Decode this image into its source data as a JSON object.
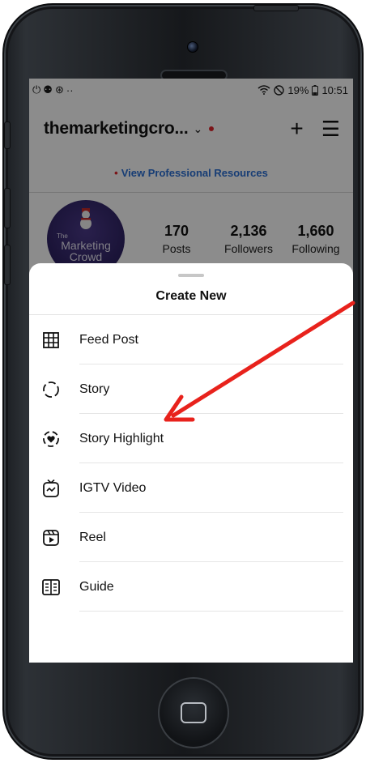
{
  "status_bar": {
    "left_icons": [
      "⏻",
      "⚉",
      "⊛",
      "··"
    ],
    "battery": "19%",
    "time": "10:51"
  },
  "header": {
    "username": "themarketingcro...",
    "chevron": "⌄",
    "plus": "+",
    "menu": "☰"
  },
  "professional_banner": {
    "dot": "•",
    "text": "View Professional Resources"
  },
  "profile": {
    "avatar_text": [
      "The",
      "Marketing",
      "Crowd"
    ],
    "stats": [
      {
        "value": "170",
        "label": "Posts"
      },
      {
        "value": "2,136",
        "label": "Followers"
      },
      {
        "value": "1,660",
        "label": "Following"
      }
    ]
  },
  "sheet": {
    "title": "Create New",
    "options": [
      {
        "label": "Feed Post",
        "icon": "grid-icon"
      },
      {
        "label": "Story",
        "icon": "story-dashed-circle-icon"
      },
      {
        "label": "Story Highlight",
        "icon": "story-highlight-heart-icon"
      },
      {
        "label": "IGTV Video",
        "icon": "igtv-icon"
      },
      {
        "label": "Reel",
        "icon": "reel-icon"
      },
      {
        "label": "Guide",
        "icon": "guide-book-icon"
      }
    ]
  },
  "colors": {
    "accent_link": "#2a6fd6",
    "notification_red": "#e0252d",
    "arrow_red": "#e8221c",
    "avatar_purple": "#3b2d78"
  }
}
